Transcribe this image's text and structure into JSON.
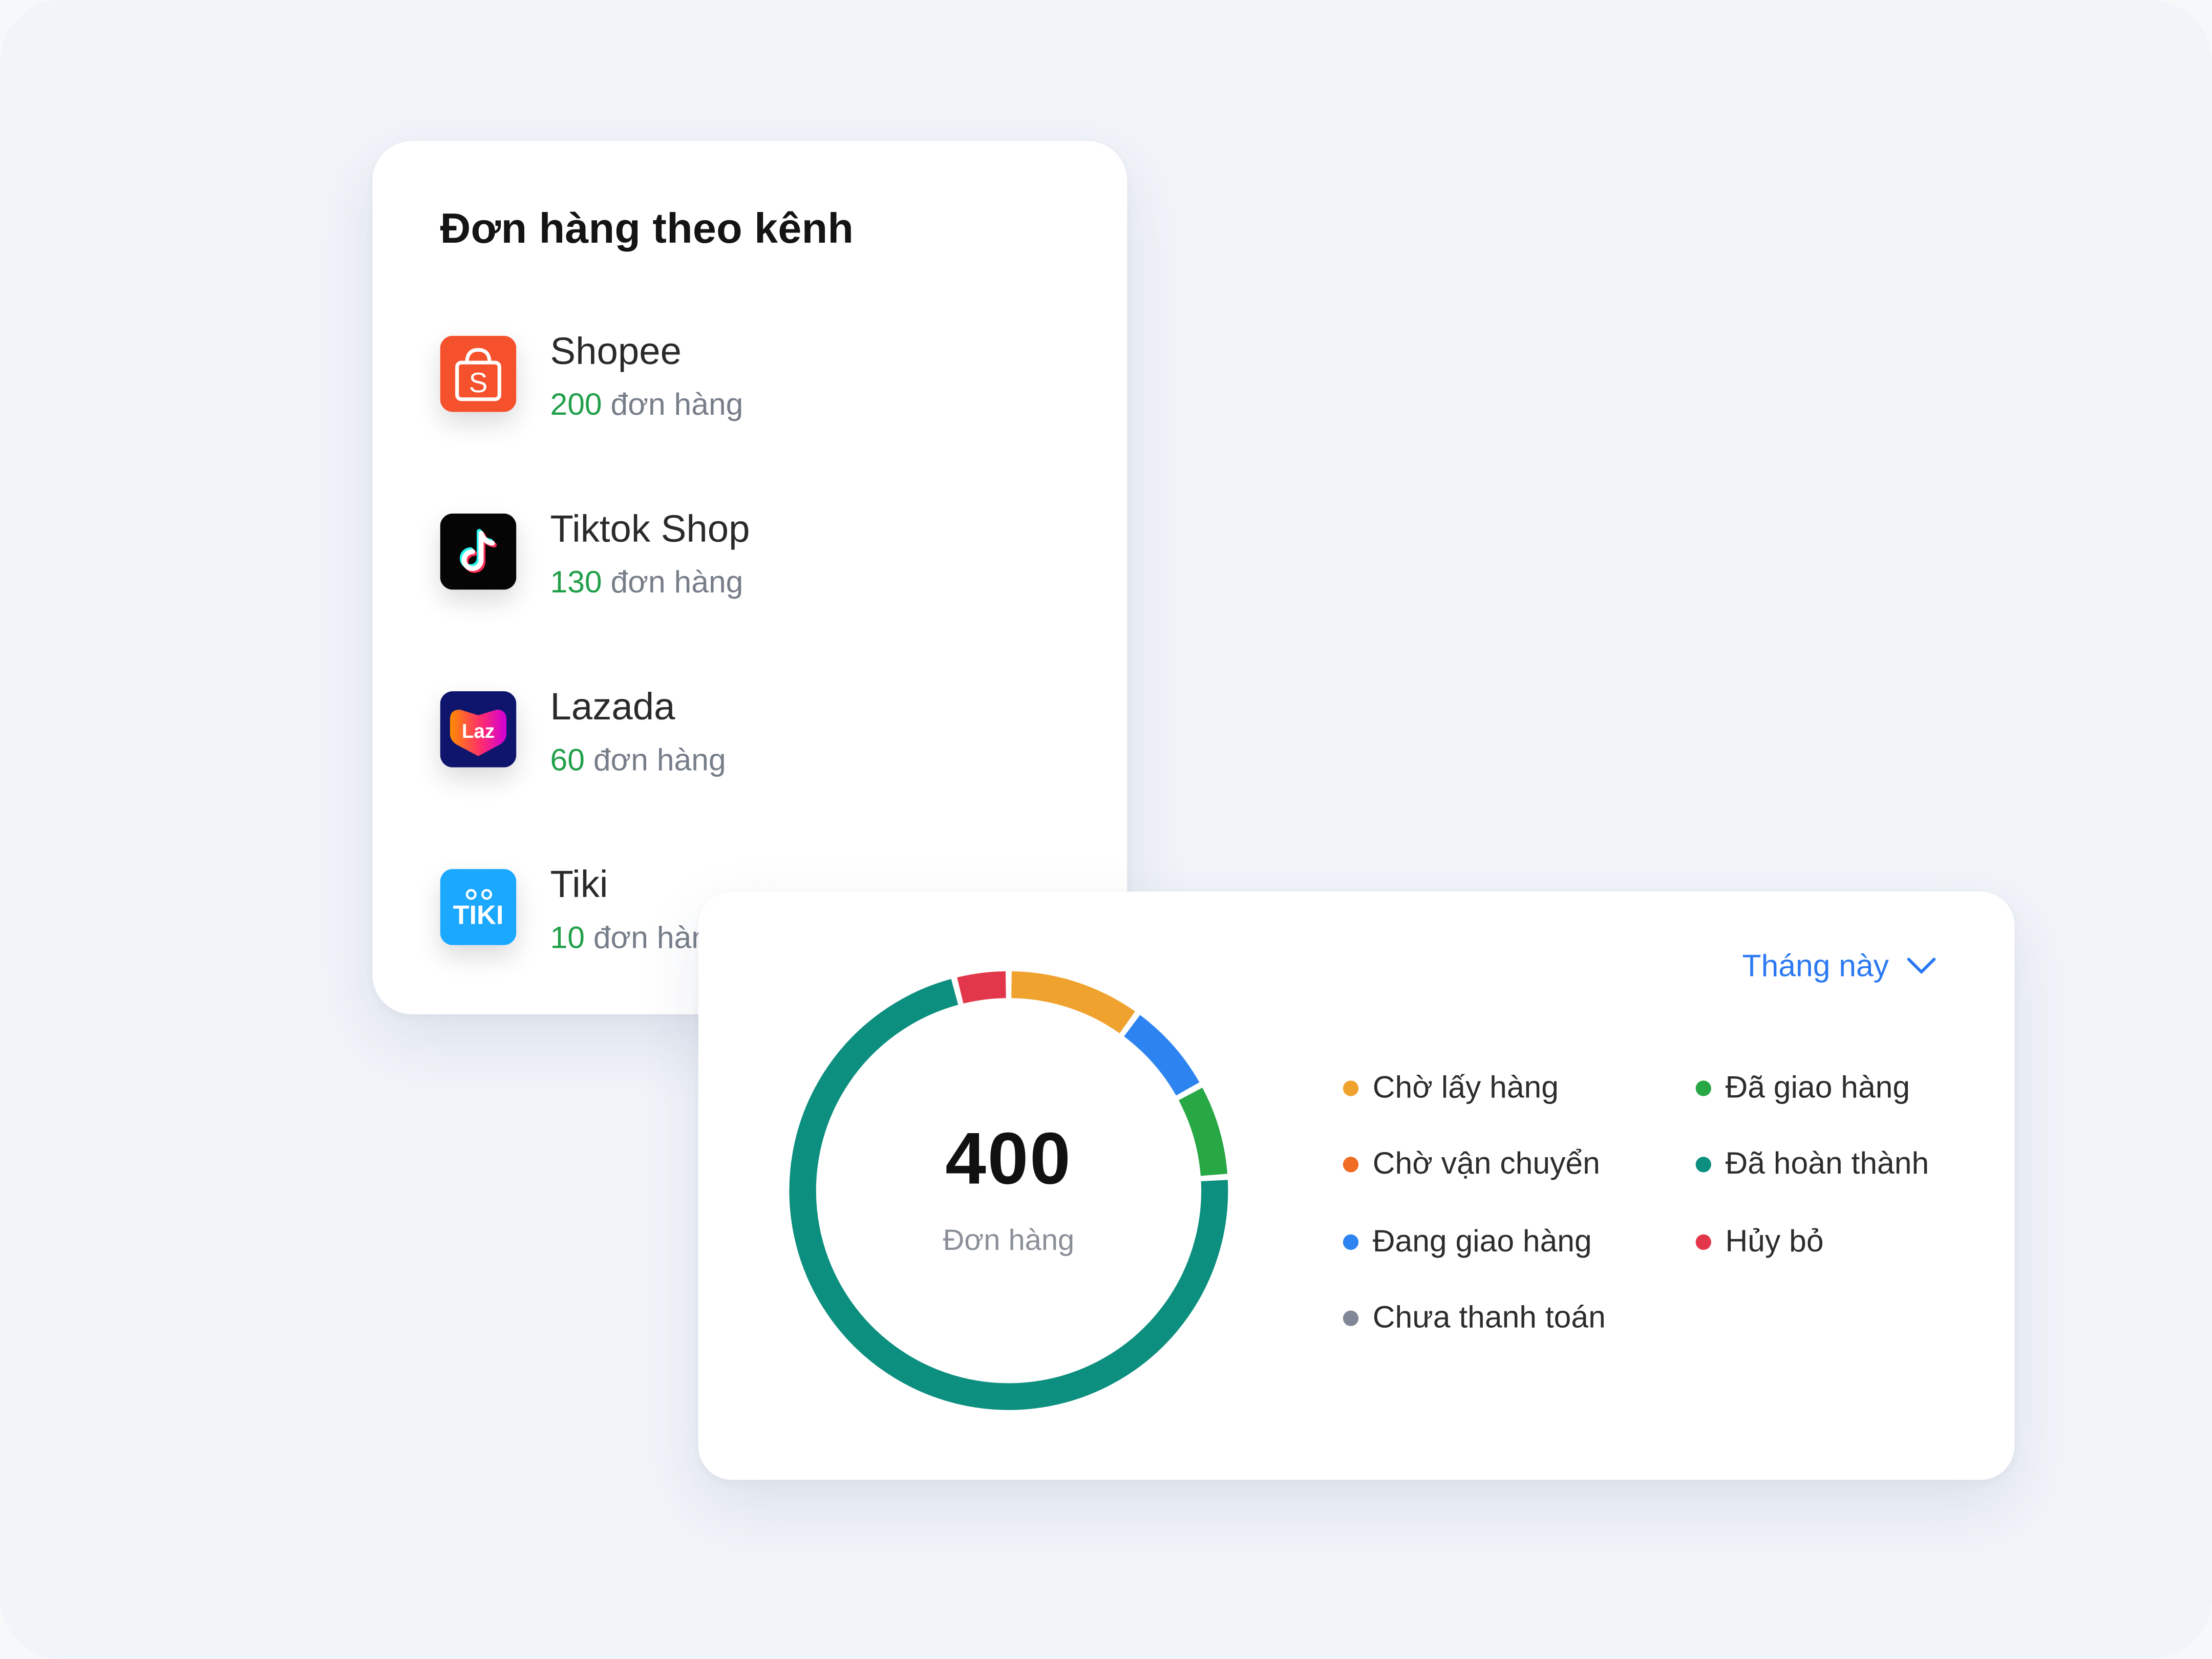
{
  "channels_card": {
    "title": "Đơn hàng theo kênh",
    "unit": "đơn hàng",
    "channels": [
      {
        "name": "Shopee",
        "count": "200",
        "icon": "shopee-logo-icon",
        "color": "#f5512c"
      },
      {
        "name": "Tiktok Shop",
        "count": "130",
        "icon": "tiktok-logo-icon",
        "color": "#000000"
      },
      {
        "name": "Lazada",
        "count": "60",
        "icon": "lazada-logo-icon",
        "color": "#0f146d"
      },
      {
        "name": "Tiki",
        "count": "10",
        "icon": "tiki-logo-icon",
        "color": "#1ba8ff"
      }
    ]
  },
  "status_card": {
    "period": "Tháng này",
    "total": "400",
    "total_label": "Đơn hàng",
    "legend": [
      {
        "label": "Chờ lấy hàng",
        "color": "#f0a22e"
      },
      {
        "label": "Chờ vận chuyển",
        "color": "#ef6c22"
      },
      {
        "label": "Đang giao hàng",
        "color": "#2d84f0"
      },
      {
        "label": "Chưa thanh toán",
        "color": "#808796"
      },
      {
        "label": "Đã giao hàng",
        "color": "#28a745"
      },
      {
        "label": "Đã hoàn thành",
        "color": "#0d8f80"
      },
      {
        "label": "Hủy bỏ",
        "color": "#e2374a"
      }
    ]
  },
  "chart_data": {
    "type": "pie",
    "variant": "donut",
    "total": 400,
    "center_label": "Đơn hàng",
    "series": [
      {
        "name": "Chờ lấy hàng",
        "value": 40,
        "color": "#f0a22e"
      },
      {
        "name": "Đang giao hàng",
        "value": 28,
        "color": "#2d84f0"
      },
      {
        "name": "Đã giao hàng",
        "value": 28,
        "color": "#28a745"
      },
      {
        "name": "Đã hoàn thành",
        "value": 288,
        "color": "#0d8f80"
      },
      {
        "name": "Hủy bỏ",
        "value": 16,
        "color": "#e2374a"
      }
    ]
  }
}
